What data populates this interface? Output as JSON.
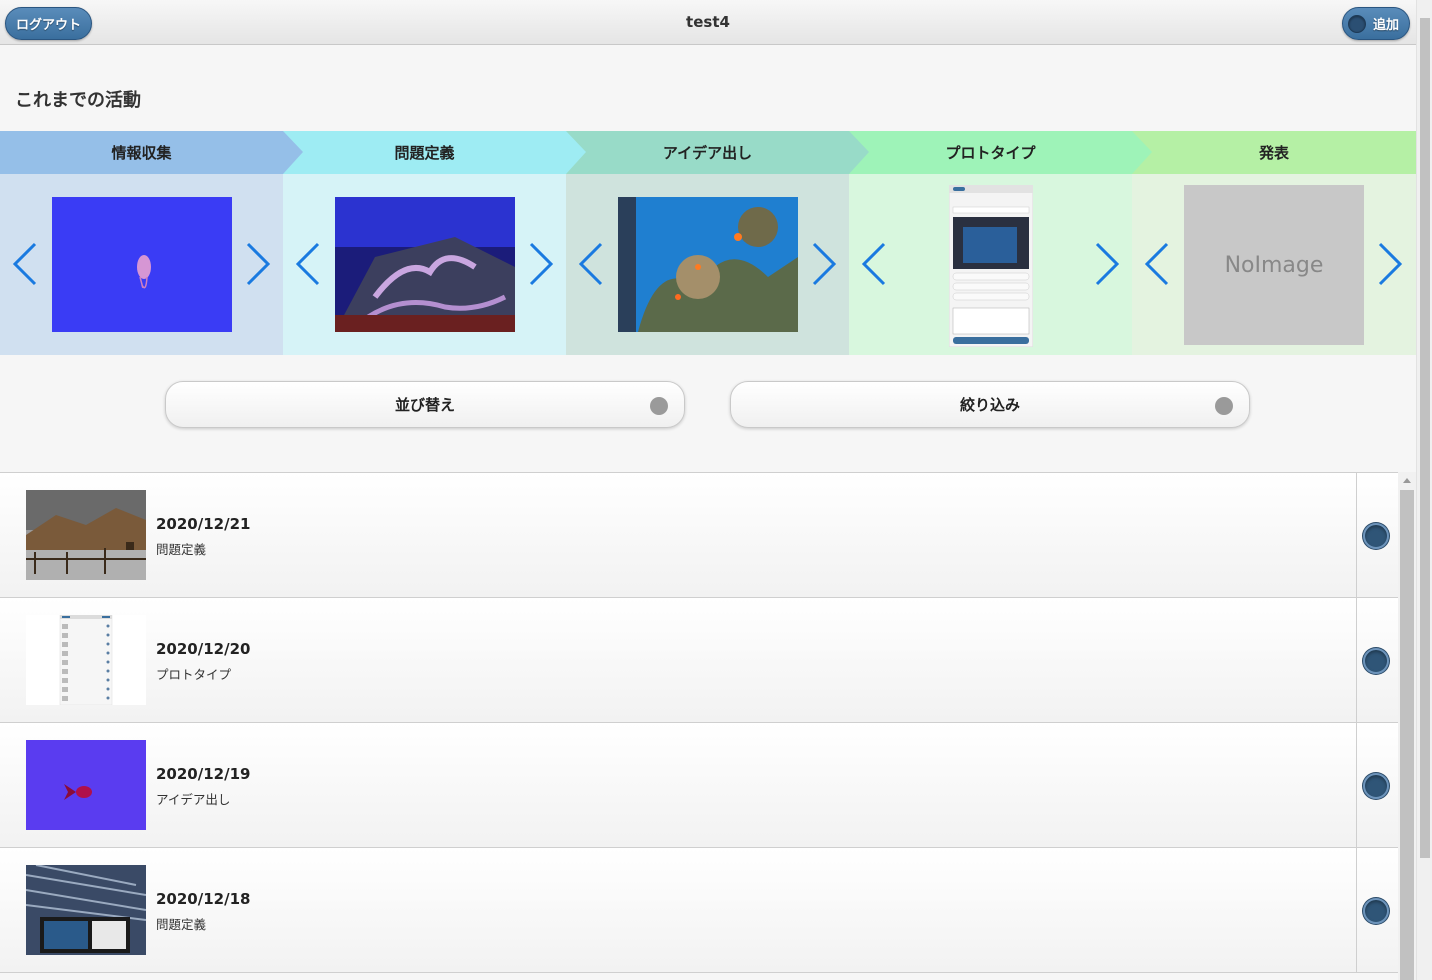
{
  "header": {
    "title": "test4",
    "logout_label": "ログアウト",
    "add_label": "追加"
  },
  "section_title": "これまでの活動",
  "stages": [
    {
      "label": "情報収集",
      "head_color": "#95bfe8",
      "body_color": "#d0e0f0",
      "image": "jellyfish-photo"
    },
    {
      "label": "問題定義",
      "head_color": "#9eecf3",
      "body_color": "#d6f3f7",
      "image": "octopus-photo"
    },
    {
      "label": "アイデア出し",
      "head_color": "#98dbc8",
      "body_color": "#cfe3dd",
      "image": "coral-reef-photo"
    },
    {
      "label": "プロトタイプ",
      "head_color": "#9ef3b8",
      "body_color": "#d8f7de",
      "image": "app-screenshot"
    },
    {
      "label": "発表",
      "head_color": "#b5f0a5",
      "body_color": "#e4f3e0",
      "image": "no-image",
      "no_image_text": "NoImage"
    }
  ],
  "controls": {
    "sort_label": "並び替え",
    "filter_label": "絞り込み"
  },
  "activities": [
    {
      "date": "2020/12/21",
      "stage": "問題定義",
      "image": "hot-spring-photo"
    },
    {
      "date": "2020/12/20",
      "stage": "プロトタイプ",
      "image": "app-list-screenshot"
    },
    {
      "date": "2020/12/19",
      "stage": "アイデア出し",
      "image": "goldfish-photo"
    },
    {
      "date": "2020/12/18",
      "stage": "問題定義",
      "image": "sardine-tank-photo"
    }
  ]
}
